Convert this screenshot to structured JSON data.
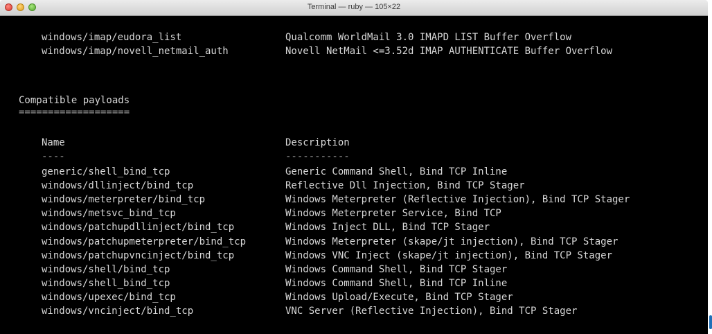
{
  "window": {
    "title": "Terminal — ruby — 105×22"
  },
  "top_rows": [
    {
      "name": "windows/imap/eudora_list",
      "description": "Qualcomm WorldMail 3.0 IMAPD LIST Buffer Overflow"
    },
    {
      "name": "windows/imap/novell_netmail_auth",
      "description": "Novell NetMail <=3.52d IMAP AUTHENTICATE Buffer Overflow"
    }
  ],
  "section": {
    "title": "Compatible payloads",
    "underline": "==================="
  },
  "table": {
    "header_name": "Name",
    "header_description": "Description",
    "rule_name": "----",
    "rule_description": "-----------",
    "rows": [
      {
        "name": "generic/shell_bind_tcp",
        "description": "Generic Command Shell, Bind TCP Inline"
      },
      {
        "name": "windows/dllinject/bind_tcp",
        "description": "Reflective Dll Injection, Bind TCP Stager"
      },
      {
        "name": "windows/meterpreter/bind_tcp",
        "description": "Windows Meterpreter (Reflective Injection), Bind TCP Stager"
      },
      {
        "name": "windows/metsvc_bind_tcp",
        "description": "Windows Meterpreter Service, Bind TCP"
      },
      {
        "name": "windows/patchupdllinject/bind_tcp",
        "description": "Windows Inject DLL, Bind TCP Stager"
      },
      {
        "name": "windows/patchupmeterpreter/bind_tcp",
        "description": "Windows Meterpreter (skape/jt injection), Bind TCP Stager"
      },
      {
        "name": "windows/patchupvncinject/bind_tcp",
        "description": "Windows VNC Inject (skape/jt injection), Bind TCP Stager"
      },
      {
        "name": "windows/shell/bind_tcp",
        "description": "Windows Command Shell, Bind TCP Stager"
      },
      {
        "name": "windows/shell_bind_tcp",
        "description": "Windows Command Shell, Bind TCP Inline"
      },
      {
        "name": "windows/upexec/bind_tcp",
        "description": "Windows Upload/Execute, Bind TCP Stager"
      },
      {
        "name": "windows/vncinject/bind_tcp",
        "description": "VNC Server (Reflective Injection), Bind TCP Stager"
      }
    ]
  }
}
